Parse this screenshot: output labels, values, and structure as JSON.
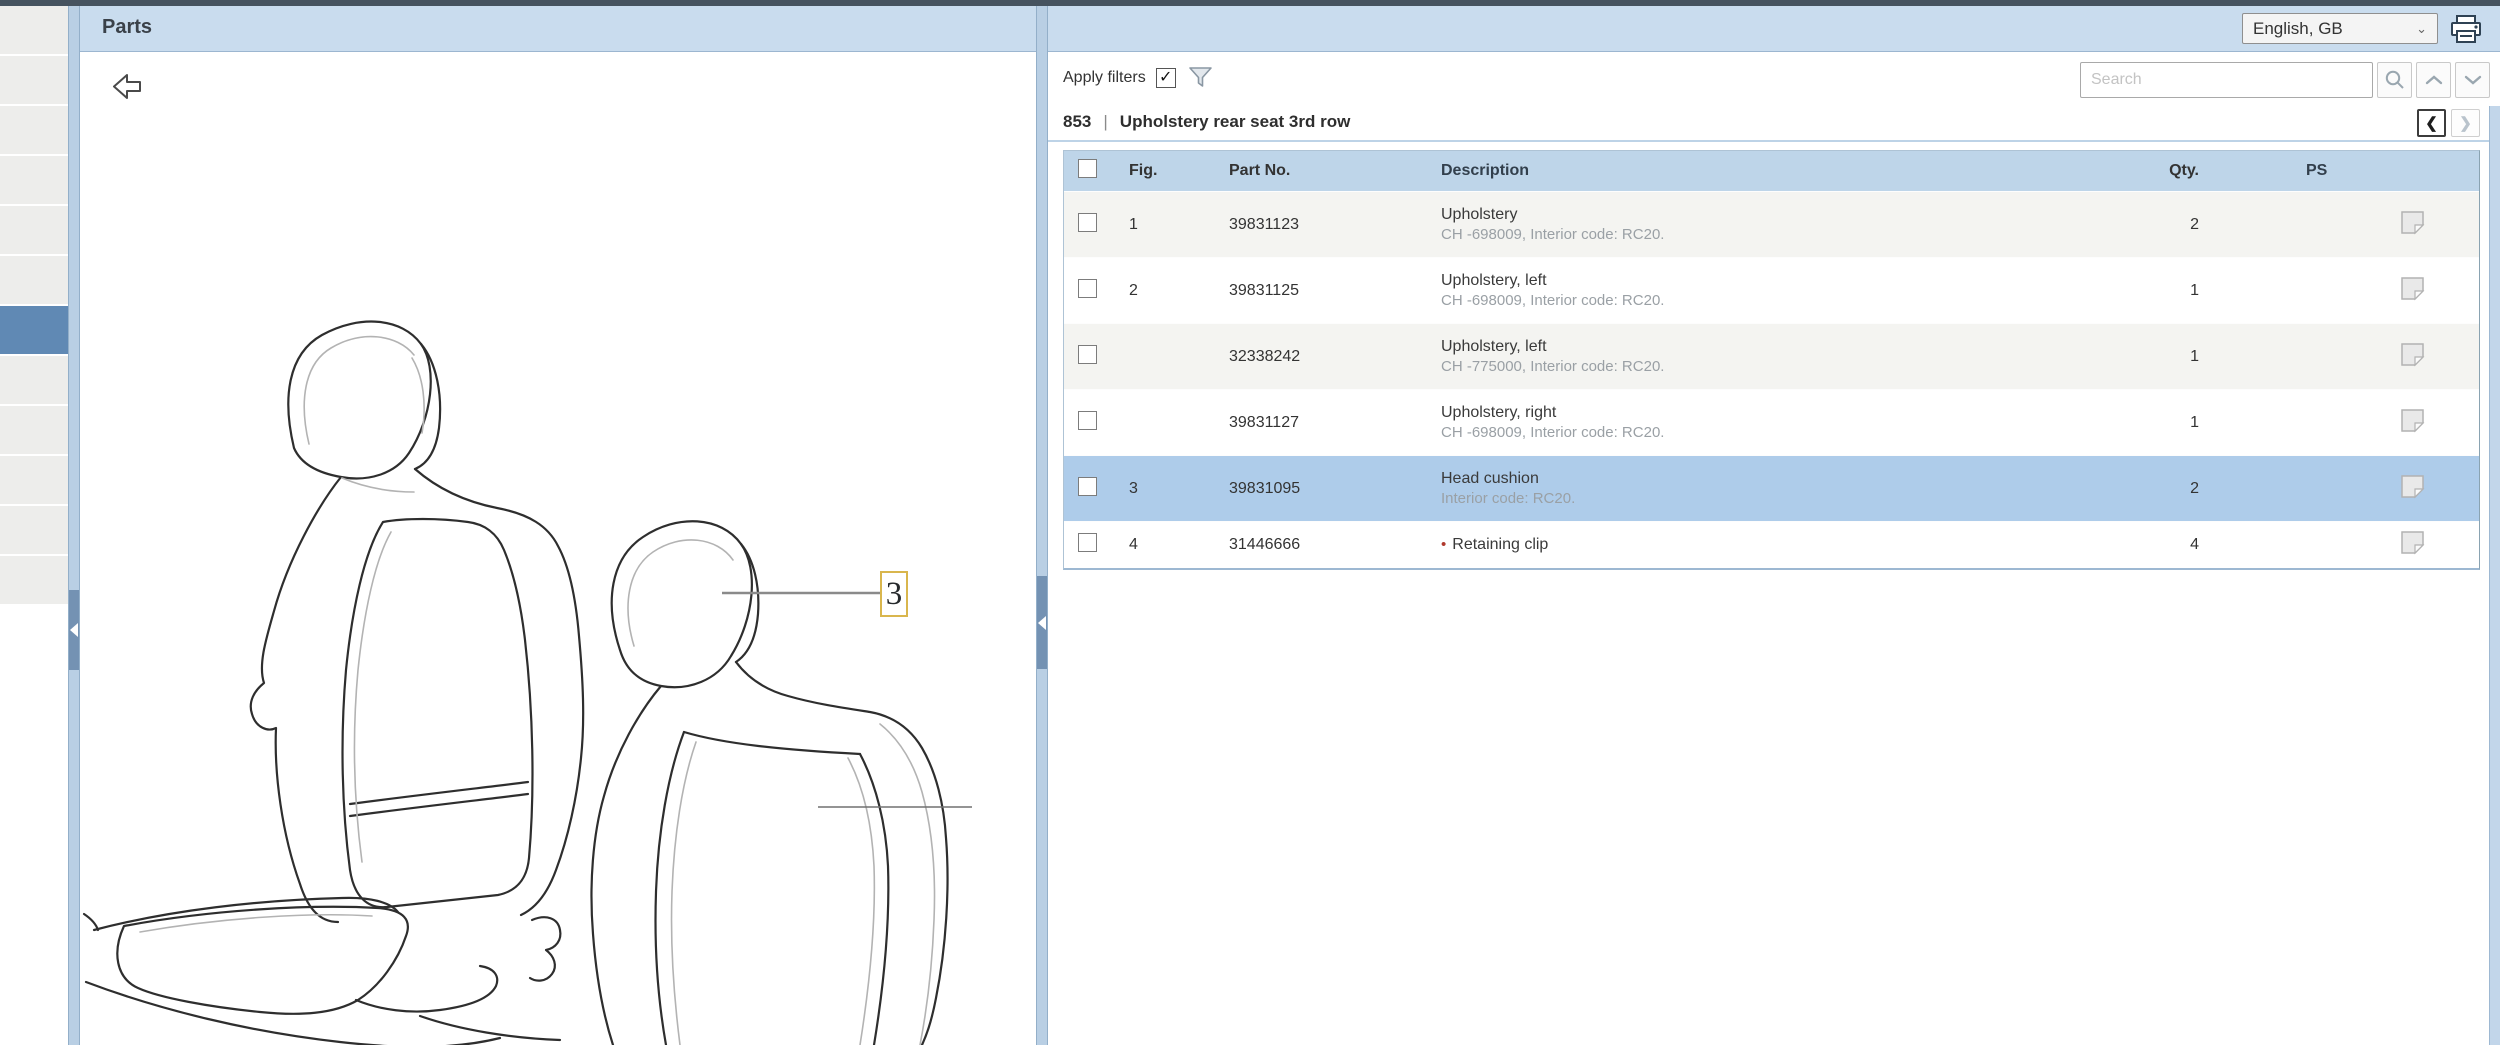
{
  "header": {
    "title": "Parts",
    "language_selected": "English, GB"
  },
  "sidebar": {
    "row_count": 12,
    "selected_index": 6
  },
  "drawing": {
    "callout_label": "3"
  },
  "toolbar": {
    "apply_filters_label": "Apply filters",
    "apply_filters_checked": true,
    "search_placeholder": "Search"
  },
  "section": {
    "code": "853",
    "separator": "|",
    "title": "Upholstery rear seat 3rd row"
  },
  "nav": {
    "prev_label": "❮",
    "next_label": "❯"
  },
  "table": {
    "headers": {
      "fig": "Fig.",
      "part": "Part No.",
      "desc": "Description",
      "qty": "Qty.",
      "ps": "PS"
    },
    "rows": [
      {
        "fig": "1",
        "part": "39831123",
        "desc": "Upholstery",
        "sub": "CH -698009, Interior code: RC20.",
        "qty": "2",
        "selected": false,
        "bullet": false
      },
      {
        "fig": "2",
        "part": "39831125",
        "desc": "Upholstery, left",
        "sub": "CH -698009, Interior code: RC20.",
        "qty": "1",
        "selected": false,
        "bullet": false
      },
      {
        "fig": "",
        "part": "32338242",
        "desc": "Upholstery, left",
        "sub": "CH -775000, Interior code: RC20.",
        "qty": "1",
        "selected": false,
        "bullet": false
      },
      {
        "fig": "",
        "part": "39831127",
        "desc": "Upholstery, right",
        "sub": "CH -698009, Interior code: RC20.",
        "qty": "1",
        "selected": false,
        "bullet": false
      },
      {
        "fig": "3",
        "part": "39831095",
        "desc": "Head cushion",
        "sub": "Interior code: RC20.",
        "qty": "2",
        "selected": true,
        "bullet": false
      },
      {
        "fig": "4",
        "part": "31446666",
        "desc": "Retaining clip",
        "sub": "",
        "qty": "4",
        "selected": false,
        "bullet": true
      }
    ]
  },
  "colors": {
    "accent_bar": "#c9dcee",
    "table_header": "#bed5e9",
    "selected_row": "#aeccea",
    "sidebar_selected": "#6089b4",
    "callout_border": "#d9b64d",
    "bullet_red": "#b03a2e"
  }
}
